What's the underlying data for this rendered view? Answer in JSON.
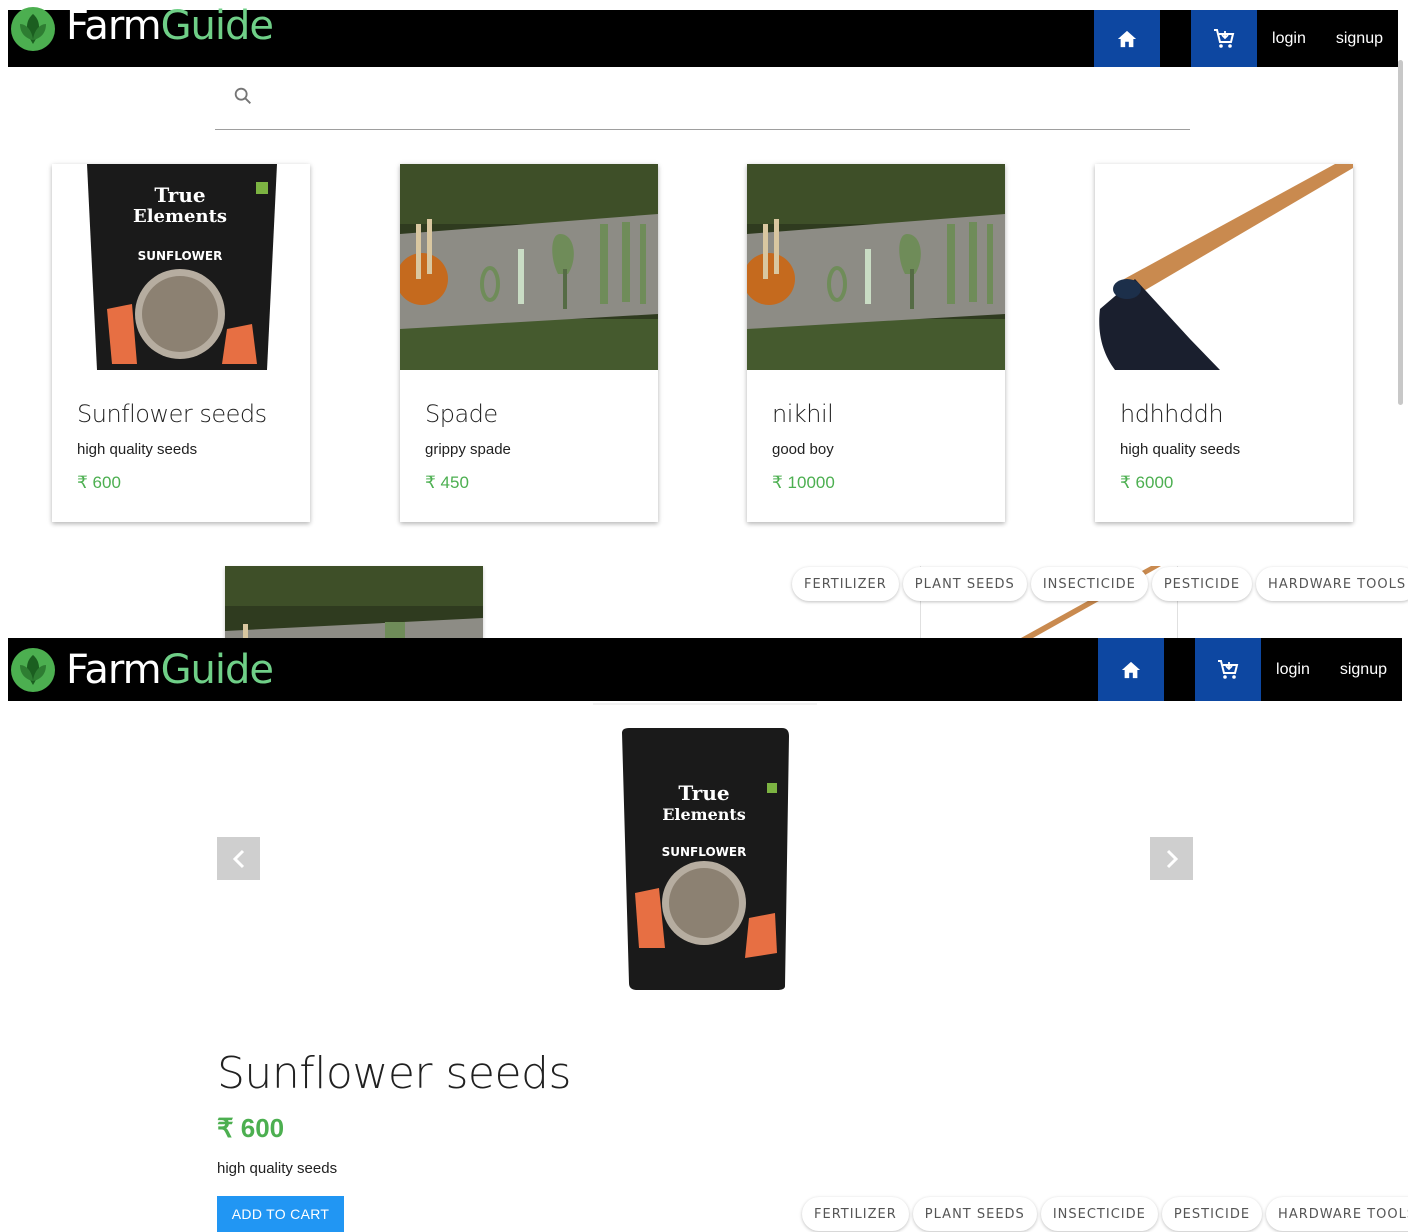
{
  "brand": {
    "part1": "Farm",
    "part2": "Guide"
  },
  "nav": {
    "home_icon": "home-icon",
    "cart_icon": "cart-icon",
    "login": "login",
    "signup": "signup"
  },
  "search": {
    "icon": "search-icon",
    "placeholder": ""
  },
  "products": [
    {
      "title": "Sunflower seeds",
      "desc": "high quality seeds",
      "price": "₹ 600",
      "image": "sunflower-seed-pack"
    },
    {
      "title": "Spade",
      "desc": "grippy spade",
      "price": "₹ 450",
      "image": "garden-tools-on-bench"
    },
    {
      "title": "nikhil",
      "desc": "good boy",
      "price": "₹ 10000",
      "image": "garden-tools-on-bench"
    },
    {
      "title": "hdhhddh",
      "desc": "high quality seeds",
      "price": "₹ 6000",
      "image": "hoe-tool"
    }
  ],
  "categories": [
    "FERTILIZER",
    "PLANT SEEDS",
    "INSECTICIDE",
    "PESTICIDE",
    "HARDWARE TOOLS"
  ],
  "detail": {
    "title": "Sunflower seeds",
    "price": "₹ 600",
    "desc": "high quality seeds",
    "add_to_cart": "ADD TO CART",
    "image": "sunflower-seed-pack"
  },
  "colors": {
    "navbar": "#000000",
    "nav_button": "#0d47a1",
    "brand_accent": "#6fcf87",
    "price": "#4caf50",
    "primary_button": "#2196f3"
  }
}
